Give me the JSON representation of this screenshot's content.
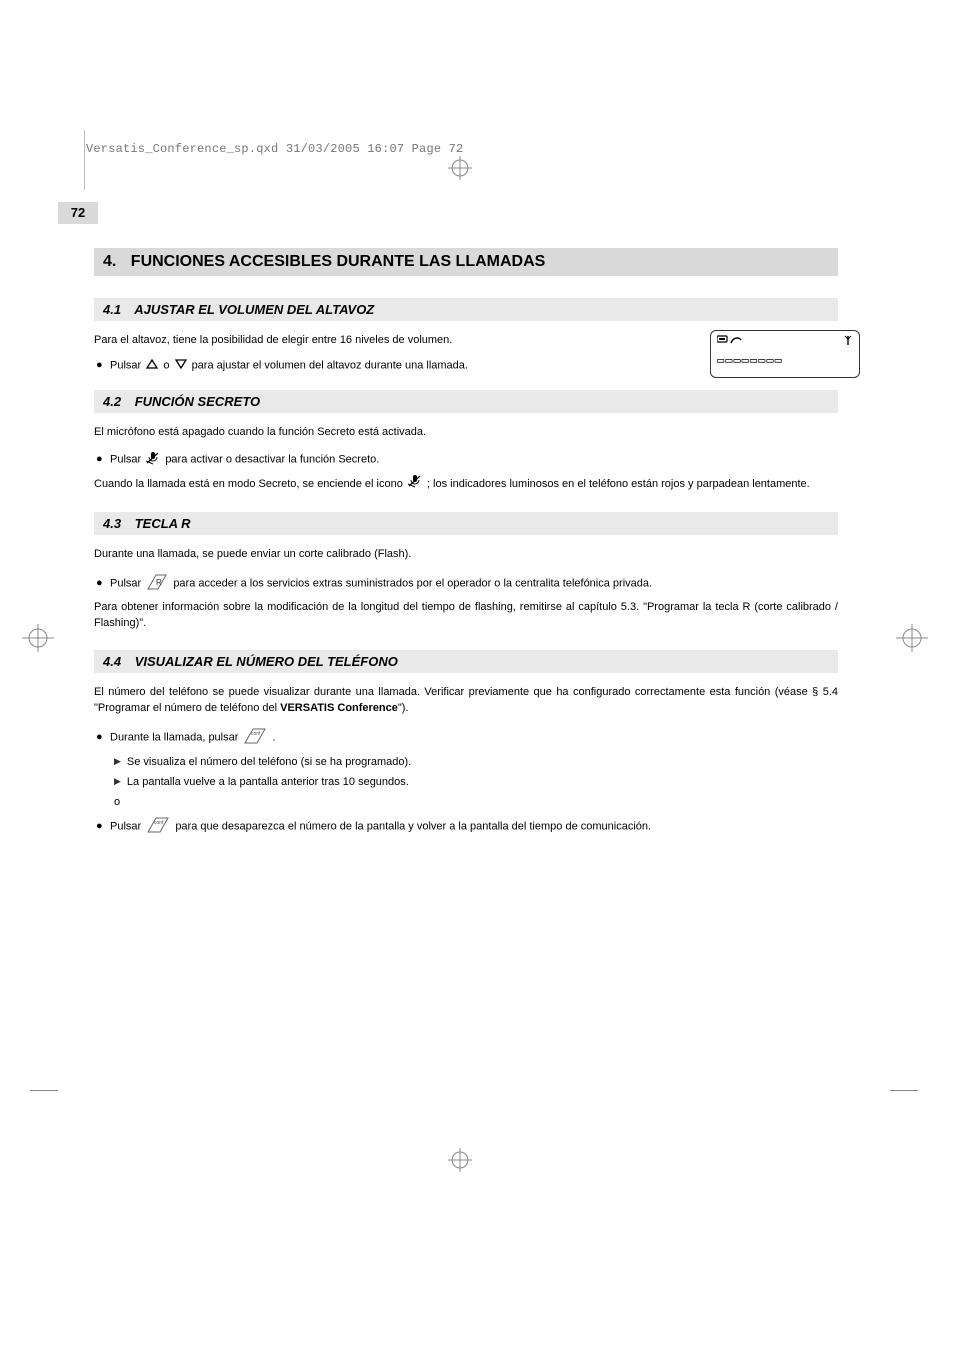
{
  "meta_header": "Versatis_Conference_sp.qxd  31/03/2005  16:07  Page 72",
  "page_number": "72",
  "chapter": {
    "num": "4.",
    "title": "FUNCIONES ACCESIBLES DURANTE LAS LLAMADAS"
  },
  "s41": {
    "num": "4.1",
    "title": "AJUSTAR EL VOLUMEN DEL ALTAVOZ",
    "p1": "Para el altavoz, tiene la posibilidad de elegir entre 16 niveles de volumen.",
    "b1_pre": "Pulsar ",
    "b1_mid": " o ",
    "b1_post": " para ajustar el volumen del altavoz durante una llamada."
  },
  "lcd": {
    "bars": "▭▭▭▭▭▭▭▭"
  },
  "s42": {
    "num": "4.2",
    "title": "FUNCIÓN SECRETO",
    "p1": "El micrófono está apagado cuando la función Secreto está activada.",
    "b1_pre": "Pulsar ",
    "b1_post": " para activar o desactivar la función Secreto.",
    "p2_pre": "Cuando la llamada está en modo Secreto, se enciende el icono ",
    "p2_post": " ; los indicadores luminosos en el teléfono están rojos y parpadean lentamente."
  },
  "s43": {
    "num": "4.3",
    "title": "TECLA R",
    "p1": "Durante una llamada, se puede enviar un corte calibrado (Flash).",
    "b1_pre": "Pulsar ",
    "b1_post": " para acceder a los servicios extras suministrados por el operador o la centralita telefónica privada.",
    "p2": "Para obtener información sobre la modificación de la longitud del tiempo de flashing, remitirse al capítulo 5.3. \"Programar la tecla R (corte calibrado / Flashing)\"."
  },
  "s44": {
    "num": "4.4",
    "title": "VISUALIZAR EL NÚMERO DEL TELÉFONO",
    "p1_pre": "El número del teléfono se puede visualizar durante una llamada. Verificar previamente que ha configurado correctamente esta función (véase § 5.4 \"Programar el número de teléfono del ",
    "p1_bold": "VERSATIS Conference",
    "p1_post": "\").",
    "b1_pre": "Durante la llamada, pulsar ",
    "b1_post": ".",
    "sub1": "Se visualiza el número del teléfono (si se ha programado).",
    "sub2": "La pantalla vuelve a la pantalla anterior tras 10 segundos.",
    "or": "o",
    "b2_pre": "Pulsar ",
    "b2_post": " para que desaparezca el número de la pantalla y volver a la pantalla del tiempo de comunicación."
  }
}
